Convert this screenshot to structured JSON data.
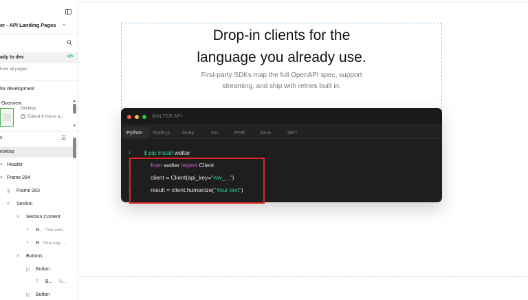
{
  "sidebar": {
    "project_name": "er - API Landing Pages",
    "dev_status": "ady to dev",
    "show_all": "how all pages",
    "dev_section": "for development",
    "overview": "Overview",
    "thumb_title": "Desktop",
    "edited": "Edited 6 hours a...",
    "layers_header": "s",
    "layers": [
      {
        "label": "esktop"
      },
      {
        "icon": "≡",
        "label": "Header"
      },
      {
        "icon": "≡",
        "label": "Frame 284"
      },
      {
        "icon": "|||",
        "label": "Frame 283"
      },
      {
        "icon": "≡",
        "label": "Section"
      },
      {
        "icon": "≡",
        "label": "Section Content"
      },
      {
        "icon": "T",
        "label": "H..",
        "text": "\"The com..."
      },
      {
        "icon": "T",
        "label": "H",
        "text": "\"One key, ..."
      },
      {
        "icon": "≡",
        "label": "Buttons"
      },
      {
        "icon": "|||",
        "label": "Button"
      },
      {
        "icon": "T",
        "label": "B...",
        "text": "\"G..."
      },
      {
        "icon": "|||",
        "label": "Button"
      }
    ]
  },
  "canvas": {
    "headline_line1": "Drop-in clients for the",
    "headline_line2": "language you already use.",
    "subtitle_line1": "First-party SDKs map the full OpenAPI spec, support",
    "subtitle_line2": "streaming, and ship with retries built in."
  },
  "code_window": {
    "title": "WALTER API",
    "dots": [
      "#ff5f57",
      "#febc2e",
      "#28c840"
    ],
    "tabs": [
      "Python",
      "Node.js",
      "Ruby",
      "Go",
      "PHP",
      "Java",
      ".NET"
    ],
    "active_tab": "Python",
    "line_numbers": [
      "1",
      "2",
      "3",
      "4"
    ],
    "line1": {
      "prompt": "$",
      "cmd": "pip install",
      "rest": "walter"
    },
    "line2": {
      "kw1": "from",
      "mod": "walter",
      "kw2": "import",
      "name": "Client"
    },
    "line3": {
      "pre": "client = Client(api_key=",
      "str": "\"ww_...\"",
      "post": ")"
    },
    "line4": {
      "pre": "result = client.humanize(",
      "str": "\"Your text\"",
      "post": ")"
    }
  }
}
